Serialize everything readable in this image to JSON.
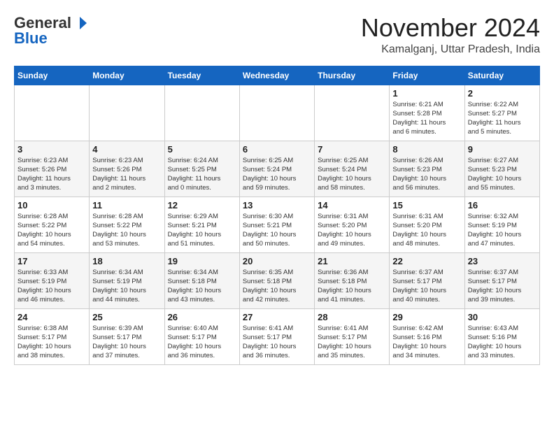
{
  "header": {
    "logo_general": "General",
    "logo_blue": "Blue",
    "month_title": "November 2024",
    "location": "Kamalganj, Uttar Pradesh, India"
  },
  "weekdays": [
    "Sunday",
    "Monday",
    "Tuesday",
    "Wednesday",
    "Thursday",
    "Friday",
    "Saturday"
  ],
  "weeks": [
    [
      {
        "day": "",
        "info": ""
      },
      {
        "day": "",
        "info": ""
      },
      {
        "day": "",
        "info": ""
      },
      {
        "day": "",
        "info": ""
      },
      {
        "day": "",
        "info": ""
      },
      {
        "day": "1",
        "info": "Sunrise: 6:21 AM\nSunset: 5:28 PM\nDaylight: 11 hours\nand 6 minutes."
      },
      {
        "day": "2",
        "info": "Sunrise: 6:22 AM\nSunset: 5:27 PM\nDaylight: 11 hours\nand 5 minutes."
      }
    ],
    [
      {
        "day": "3",
        "info": "Sunrise: 6:23 AM\nSunset: 5:26 PM\nDaylight: 11 hours\nand 3 minutes."
      },
      {
        "day": "4",
        "info": "Sunrise: 6:23 AM\nSunset: 5:26 PM\nDaylight: 11 hours\nand 2 minutes."
      },
      {
        "day": "5",
        "info": "Sunrise: 6:24 AM\nSunset: 5:25 PM\nDaylight: 11 hours\nand 0 minutes."
      },
      {
        "day": "6",
        "info": "Sunrise: 6:25 AM\nSunset: 5:24 PM\nDaylight: 10 hours\nand 59 minutes."
      },
      {
        "day": "7",
        "info": "Sunrise: 6:25 AM\nSunset: 5:24 PM\nDaylight: 10 hours\nand 58 minutes."
      },
      {
        "day": "8",
        "info": "Sunrise: 6:26 AM\nSunset: 5:23 PM\nDaylight: 10 hours\nand 56 minutes."
      },
      {
        "day": "9",
        "info": "Sunrise: 6:27 AM\nSunset: 5:23 PM\nDaylight: 10 hours\nand 55 minutes."
      }
    ],
    [
      {
        "day": "10",
        "info": "Sunrise: 6:28 AM\nSunset: 5:22 PM\nDaylight: 10 hours\nand 54 minutes."
      },
      {
        "day": "11",
        "info": "Sunrise: 6:28 AM\nSunset: 5:22 PM\nDaylight: 10 hours\nand 53 minutes."
      },
      {
        "day": "12",
        "info": "Sunrise: 6:29 AM\nSunset: 5:21 PM\nDaylight: 10 hours\nand 51 minutes."
      },
      {
        "day": "13",
        "info": "Sunrise: 6:30 AM\nSunset: 5:21 PM\nDaylight: 10 hours\nand 50 minutes."
      },
      {
        "day": "14",
        "info": "Sunrise: 6:31 AM\nSunset: 5:20 PM\nDaylight: 10 hours\nand 49 minutes."
      },
      {
        "day": "15",
        "info": "Sunrise: 6:31 AM\nSunset: 5:20 PM\nDaylight: 10 hours\nand 48 minutes."
      },
      {
        "day": "16",
        "info": "Sunrise: 6:32 AM\nSunset: 5:19 PM\nDaylight: 10 hours\nand 47 minutes."
      }
    ],
    [
      {
        "day": "17",
        "info": "Sunrise: 6:33 AM\nSunset: 5:19 PM\nDaylight: 10 hours\nand 46 minutes."
      },
      {
        "day": "18",
        "info": "Sunrise: 6:34 AM\nSunset: 5:19 PM\nDaylight: 10 hours\nand 44 minutes."
      },
      {
        "day": "19",
        "info": "Sunrise: 6:34 AM\nSunset: 5:18 PM\nDaylight: 10 hours\nand 43 minutes."
      },
      {
        "day": "20",
        "info": "Sunrise: 6:35 AM\nSunset: 5:18 PM\nDaylight: 10 hours\nand 42 minutes."
      },
      {
        "day": "21",
        "info": "Sunrise: 6:36 AM\nSunset: 5:18 PM\nDaylight: 10 hours\nand 41 minutes."
      },
      {
        "day": "22",
        "info": "Sunrise: 6:37 AM\nSunset: 5:17 PM\nDaylight: 10 hours\nand 40 minutes."
      },
      {
        "day": "23",
        "info": "Sunrise: 6:37 AM\nSunset: 5:17 PM\nDaylight: 10 hours\nand 39 minutes."
      }
    ],
    [
      {
        "day": "24",
        "info": "Sunrise: 6:38 AM\nSunset: 5:17 PM\nDaylight: 10 hours\nand 38 minutes."
      },
      {
        "day": "25",
        "info": "Sunrise: 6:39 AM\nSunset: 5:17 PM\nDaylight: 10 hours\nand 37 minutes."
      },
      {
        "day": "26",
        "info": "Sunrise: 6:40 AM\nSunset: 5:17 PM\nDaylight: 10 hours\nand 36 minutes."
      },
      {
        "day": "27",
        "info": "Sunrise: 6:41 AM\nSunset: 5:17 PM\nDaylight: 10 hours\nand 36 minutes."
      },
      {
        "day": "28",
        "info": "Sunrise: 6:41 AM\nSunset: 5:17 PM\nDaylight: 10 hours\nand 35 minutes."
      },
      {
        "day": "29",
        "info": "Sunrise: 6:42 AM\nSunset: 5:16 PM\nDaylight: 10 hours\nand 34 minutes."
      },
      {
        "day": "30",
        "info": "Sunrise: 6:43 AM\nSunset: 5:16 PM\nDaylight: 10 hours\nand 33 minutes."
      }
    ]
  ]
}
